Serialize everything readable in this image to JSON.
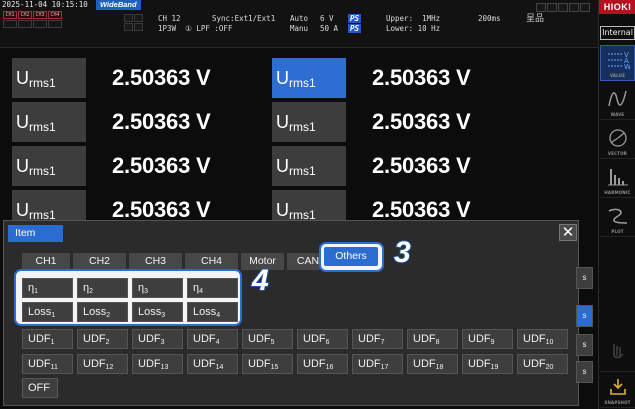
{
  "status": {
    "datetime": "2025-11-04 10:15:10",
    "mode_badge": "WideBand",
    "channels": [
      "CH1",
      "CH2",
      "CH3",
      "CH4"
    ],
    "ch_line1": "CH 12",
    "ch_line2": "1P3W  ① LPF :OFF",
    "sync_line": "Sync:Ext1/Ext1",
    "range_v_mode": "Auto",
    "range_v": "6 V",
    "range_a_mode": "Manu",
    "range_a": "50 A",
    "ps": "PS",
    "upper": "Upper:  1MHz",
    "lower": "Lower: 10 Hz",
    "time_window": "200ms",
    "hold_symbol": "呈品"
  },
  "sidebar": {
    "brand": "HIOKI",
    "internal": "Internal",
    "buttons": [
      "VALUE",
      "WAVE",
      "VECTOR",
      "HARMONIC",
      "PLOT",
      "",
      "SNAPSHOT"
    ]
  },
  "measurements": [
    {
      "label": "U",
      "sub": "rms1",
      "value": "2.50363  V"
    },
    {
      "label": "U",
      "sub": "rms1",
      "value": "2.50363  V"
    },
    {
      "label": "U",
      "sub": "rms1",
      "value": "2.50363  V"
    },
    {
      "label": "U",
      "sub": "rms1",
      "value": "2.50363  V"
    },
    {
      "label": "U",
      "sub": "rms1",
      "value": "2.50363  V"
    },
    {
      "label": "U",
      "sub": "rms1",
      "value": "2.50363  V"
    },
    {
      "label": "U",
      "sub": "rms1",
      "value": "2.50363  V"
    },
    {
      "label": "U",
      "sub": "rms1",
      "value": "2.50363  V"
    }
  ],
  "dialog": {
    "title": "Item",
    "close": "✕",
    "tabs": [
      "CH1",
      "CH2",
      "CH3",
      "CH4",
      "Motor",
      "CAN",
      "Others"
    ],
    "active_tab": "Others",
    "eta": [
      {
        "b": "η",
        "s": "1"
      },
      {
        "b": "η",
        "s": "2"
      },
      {
        "b": "η",
        "s": "3"
      },
      {
        "b": "η",
        "s": "4"
      }
    ],
    "loss": [
      {
        "b": "Loss",
        "s": "1"
      },
      {
        "b": "Loss",
        "s": "2"
      },
      {
        "b": "Loss",
        "s": "3"
      },
      {
        "b": "Loss",
        "s": "4"
      }
    ],
    "udf_row1": [
      {
        "b": "UDF",
        "s": "1"
      },
      {
        "b": "UDF",
        "s": "2"
      },
      {
        "b": "UDF",
        "s": "3"
      },
      {
        "b": "UDF",
        "s": "4"
      },
      {
        "b": "UDF",
        "s": "5"
      },
      {
        "b": "UDF",
        "s": "6"
      },
      {
        "b": "UDF",
        "s": "7"
      },
      {
        "b": "UDF",
        "s": "8"
      },
      {
        "b": "UDF",
        "s": "9"
      },
      {
        "b": "UDF",
        "s": "10"
      }
    ],
    "udf_row2": [
      {
        "b": "UDF",
        "s": "11"
      },
      {
        "b": "UDF",
        "s": "12"
      },
      {
        "b": "UDF",
        "s": "13"
      },
      {
        "b": "UDF",
        "s": "14"
      },
      {
        "b": "UDF",
        "s": "15"
      },
      {
        "b": "UDF",
        "s": "16"
      },
      {
        "b": "UDF",
        "s": "17"
      },
      {
        "b": "UDF",
        "s": "18"
      },
      {
        "b": "UDF",
        "s": "19"
      },
      {
        "b": "UDF",
        "s": "20"
      }
    ],
    "off": "OFF",
    "side_labels": [
      "s",
      "s",
      "s",
      "s"
    ]
  },
  "callouts": {
    "step3": "3",
    "step4": "4"
  },
  "colors": {
    "accent": "#2b6cd0",
    "brand": "#b3121f",
    "label_bg": "#3d3d3d"
  }
}
